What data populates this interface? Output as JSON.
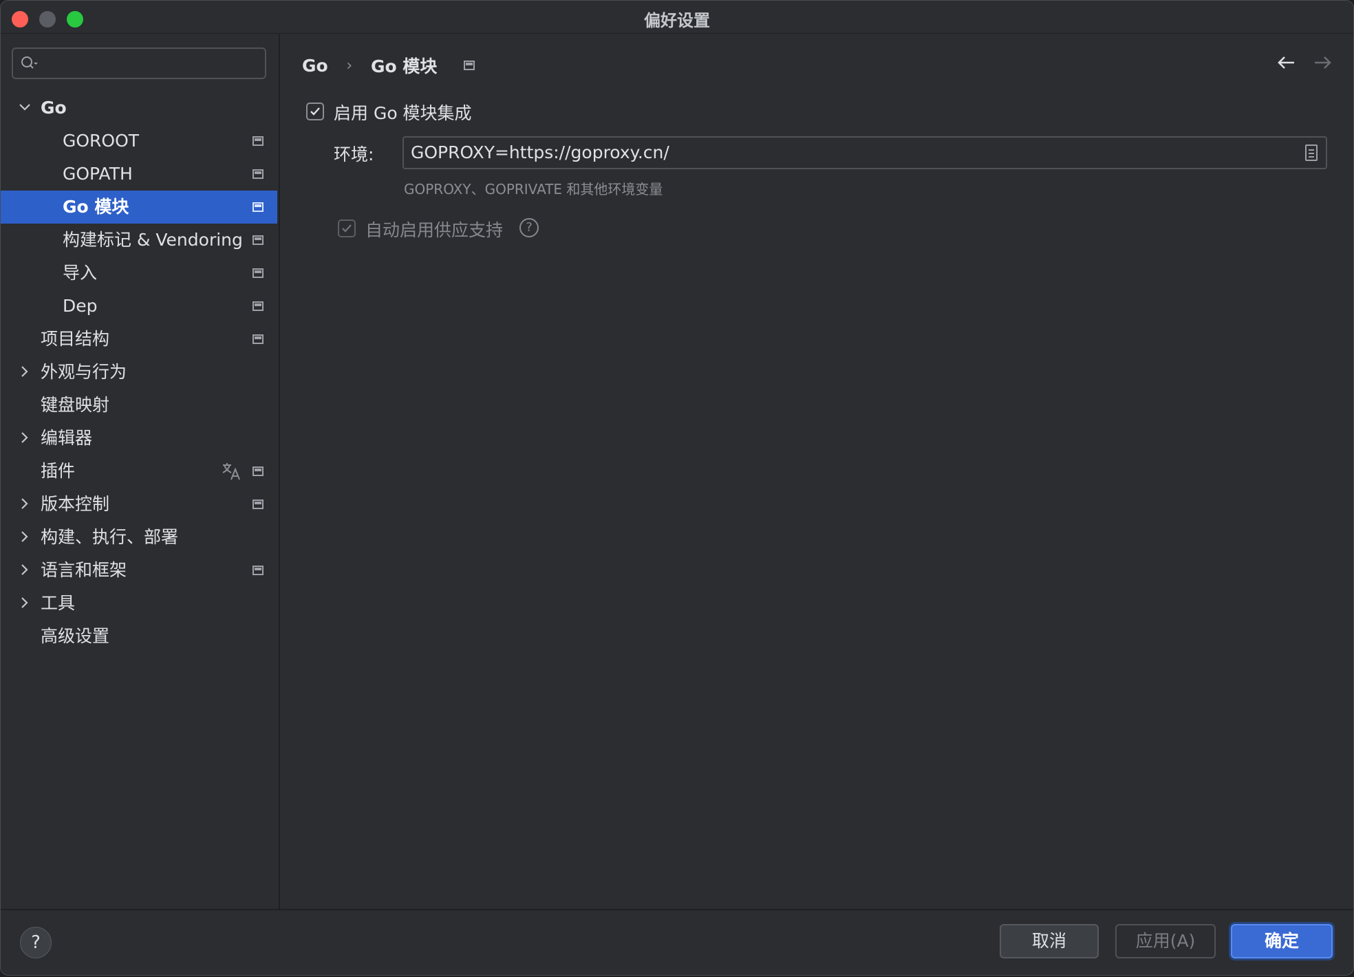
{
  "window": {
    "title": "偏好设置"
  },
  "search": {
    "placeholder": ""
  },
  "tree": [
    {
      "label": "Go",
      "expanded": true,
      "bold": true
    },
    {
      "label": "GOROOT"
    },
    {
      "label": "GOPATH"
    },
    {
      "label": "Go 模块",
      "selected": true
    },
    {
      "label": "构建标记 & Vendoring"
    },
    {
      "label": "导入"
    },
    {
      "label": "Dep"
    },
    {
      "label": "项目结构"
    },
    {
      "label": "外观与行为"
    },
    {
      "label": "键盘映射"
    },
    {
      "label": "编辑器"
    },
    {
      "label": "插件"
    },
    {
      "label": "版本控制"
    },
    {
      "label": "构建、执行、部署"
    },
    {
      "label": "语言和框架"
    },
    {
      "label": "工具"
    },
    {
      "label": "高级设置"
    }
  ],
  "breadcrumb": {
    "parent": "Go",
    "separator": "›",
    "current": "Go 模块"
  },
  "settings": {
    "enable_integration": {
      "label": "启用 Go 模块集成",
      "checked": true
    },
    "environment": {
      "label": "环境:",
      "value": "GOPROXY=https://goproxy.cn/",
      "hint": "GOPROXY、GOPRIVATE 和其他环境变量"
    },
    "auto_vendoring": {
      "label": "自动启用供应支持",
      "checked": true,
      "enabled": false
    }
  },
  "footer": {
    "help_label": "?",
    "cancel_label": "取消",
    "apply_label": "应用(A)",
    "ok_label": "确定"
  },
  "colors": {
    "selection": "#2e60c9",
    "accent_button": "#3a6ad4",
    "close": "#ff5f57",
    "maximize": "#28c840"
  }
}
